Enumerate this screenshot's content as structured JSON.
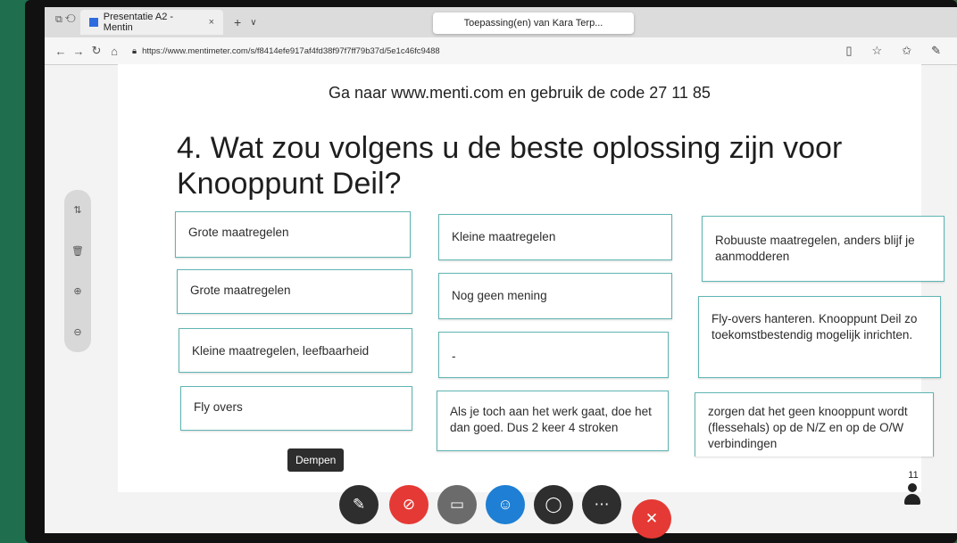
{
  "browser": {
    "tab_title": "Presentatie A2 - Mentin",
    "tab_close": "×",
    "new_tab": "+",
    "tab_menu": "∨",
    "popup_title": "Toepassing(en) van Kara Terp...",
    "url": "https://www.mentimeter.com/s/f8414efe917af4fd38f97f7ff79b37d/5e1c46fc9488",
    "icons": [
      "back-icon",
      "forward-icon",
      "refresh-icon",
      "home-icon",
      "lock-icon",
      "reading-view-icon",
      "favorite-icon",
      "favorites-bar-icon",
      "pen-icon"
    ]
  },
  "slide": {
    "instruction": "Ga naar www.menti.com en gebruik de code 27 11 85",
    "question": "4. Wat zou volgens u de beste oplossing zijn voor Knooppunt Deil?",
    "cards": [
      {
        "text": "Grote maatregelen"
      },
      {
        "text": "Grote maatregelen"
      },
      {
        "text": "Kleine maatregelen, leefbaarheid"
      },
      {
        "text": "Fly overs"
      },
      {
        "text": "Kleine maatregelen"
      },
      {
        "text": "Nog geen mening"
      },
      {
        "text": "-"
      },
      {
        "text": "Als je toch aan het werk gaat, doe het dan goed. Dus 2 keer 4 stroken"
      },
      {
        "text": "Robuuste maatregelen, anders blijf je aanmodderen"
      },
      {
        "text": "Fly-overs hanteren. Knooppunt Deil zo toekomstbestendig mogelijk inrichten."
      },
      {
        "text": "zorgen dat het geen knooppunt wordt (flessehals) op de N/Z en op de O/W verbindingen"
      }
    ],
    "participant_count": "11"
  },
  "meeting": {
    "tooltip": "Dempen",
    "colors": {
      "red": "#e53935",
      "blue": "#1e7fd4",
      "dark": "#2e2e2e",
      "gray": "#6b6b6b"
    }
  },
  "sidetools": [
    "presenter-icon",
    "delete-icon",
    "zoom-in-icon",
    "zoom-out-icon"
  ]
}
